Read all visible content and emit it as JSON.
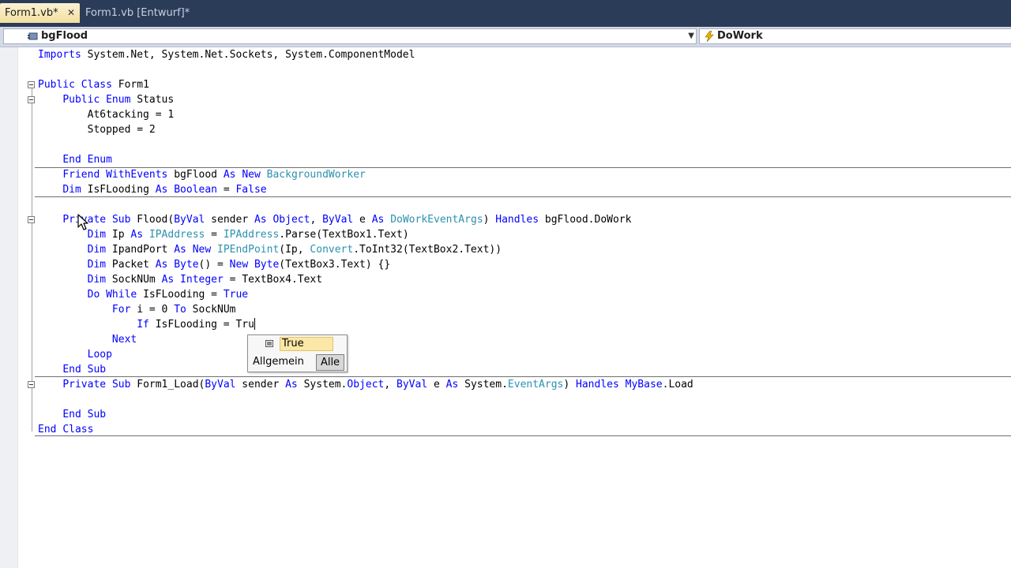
{
  "tabs": [
    {
      "label": "Form1.vb*",
      "active": true,
      "close_glyph": "✕"
    },
    {
      "label": "Form1.vb [Entwurf]*",
      "active": false
    }
  ],
  "navbar": {
    "class_combo": "bgFlood",
    "method_combo": "DoWork",
    "class_icon": "component-icon",
    "method_icon": "event-lightning-icon"
  },
  "code_lines": [
    [
      {
        "t": "Imports",
        "c": "kw"
      },
      {
        "t": " System.Net, System.Net.Sockets, System.ComponentModel"
      }
    ],
    [],
    [
      {
        "t": "Public",
        "c": "kw"
      },
      {
        "t": " "
      },
      {
        "t": "Class",
        "c": "kw"
      },
      {
        "t": " Form1"
      }
    ],
    [
      {
        "t": "    "
      },
      {
        "t": "Public",
        "c": "kw"
      },
      {
        "t": " "
      },
      {
        "t": "Enum",
        "c": "kw"
      },
      {
        "t": " Status"
      }
    ],
    [
      {
        "t": "        At6tacking = 1"
      }
    ],
    [
      {
        "t": "        Stopped = 2"
      }
    ],
    [],
    [
      {
        "t": "    "
      },
      {
        "t": "End",
        "c": "kw"
      },
      {
        "t": " "
      },
      {
        "t": "Enum",
        "c": "kw"
      }
    ],
    [
      {
        "t": "    "
      },
      {
        "t": "Friend",
        "c": "kw"
      },
      {
        "t": " "
      },
      {
        "t": "WithEvents",
        "c": "kw"
      },
      {
        "t": " bgFlood "
      },
      {
        "t": "As",
        "c": "kw"
      },
      {
        "t": " "
      },
      {
        "t": "New",
        "c": "kw"
      },
      {
        "t": " "
      },
      {
        "t": "BackgroundWorker",
        "c": "ty"
      }
    ],
    [
      {
        "t": "    "
      },
      {
        "t": "Dim",
        "c": "kw"
      },
      {
        "t": " IsFLooding "
      },
      {
        "t": "As",
        "c": "kw"
      },
      {
        "t": " "
      },
      {
        "t": "Boolean",
        "c": "kw"
      },
      {
        "t": " = "
      },
      {
        "t": "False",
        "c": "kw"
      }
    ],
    [],
    [
      {
        "t": "    "
      },
      {
        "t": "Private",
        "c": "kw"
      },
      {
        "t": " "
      },
      {
        "t": "Sub",
        "c": "kw"
      },
      {
        "t": " Flood("
      },
      {
        "t": "ByVal",
        "c": "kw"
      },
      {
        "t": " sender "
      },
      {
        "t": "As",
        "c": "kw"
      },
      {
        "t": " "
      },
      {
        "t": "Object",
        "c": "kw"
      },
      {
        "t": ", "
      },
      {
        "t": "ByVal",
        "c": "kw"
      },
      {
        "t": " e "
      },
      {
        "t": "As",
        "c": "kw"
      },
      {
        "t": " "
      },
      {
        "t": "DoWorkEventArgs",
        "c": "ty"
      },
      {
        "t": ") "
      },
      {
        "t": "Handles",
        "c": "kw"
      },
      {
        "t": " bgFlood.DoWork"
      }
    ],
    [
      {
        "t": "        "
      },
      {
        "t": "Dim",
        "c": "kw"
      },
      {
        "t": " Ip "
      },
      {
        "t": "As",
        "c": "kw"
      },
      {
        "t": " "
      },
      {
        "t": "IPAddress",
        "c": "ty"
      },
      {
        "t": " = "
      },
      {
        "t": "IPAddress",
        "c": "ty"
      },
      {
        "t": ".Parse(TextBox1.Text)"
      }
    ],
    [
      {
        "t": "        "
      },
      {
        "t": "Dim",
        "c": "kw"
      },
      {
        "t": " IpandPort "
      },
      {
        "t": "As",
        "c": "kw"
      },
      {
        "t": " "
      },
      {
        "t": "New",
        "c": "kw"
      },
      {
        "t": " "
      },
      {
        "t": "IPEndPoint",
        "c": "ty"
      },
      {
        "t": "(Ip, "
      },
      {
        "t": "Convert",
        "c": "ty"
      },
      {
        "t": ".ToInt32(TextBox2.Text))"
      }
    ],
    [
      {
        "t": "        "
      },
      {
        "t": "Dim",
        "c": "kw"
      },
      {
        "t": " Packet "
      },
      {
        "t": "As",
        "c": "kw"
      },
      {
        "t": " "
      },
      {
        "t": "Byte",
        "c": "kw"
      },
      {
        "t": "() = "
      },
      {
        "t": "New",
        "c": "kw"
      },
      {
        "t": " "
      },
      {
        "t": "Byte",
        "c": "kw"
      },
      {
        "t": "(TextBox3.Text) {}"
      }
    ],
    [
      {
        "t": "        "
      },
      {
        "t": "Dim",
        "c": "kw"
      },
      {
        "t": " SockNUm "
      },
      {
        "t": "As",
        "c": "kw"
      },
      {
        "t": " "
      },
      {
        "t": "Integer",
        "c": "kw"
      },
      {
        "t": " = TextBox4.Text"
      }
    ],
    [
      {
        "t": "        "
      },
      {
        "t": "Do",
        "c": "kw"
      },
      {
        "t": " "
      },
      {
        "t": "While",
        "c": "kw"
      },
      {
        "t": " IsFLooding = "
      },
      {
        "t": "True",
        "c": "kw"
      }
    ],
    [
      {
        "t": "            "
      },
      {
        "t": "For",
        "c": "kw"
      },
      {
        "t": " i = 0 "
      },
      {
        "t": "To",
        "c": "kw"
      },
      {
        "t": " SockNUm"
      }
    ],
    [
      {
        "t": "                "
      },
      {
        "t": "If",
        "c": "kw"
      },
      {
        "t": " IsFLooding = Tru"
      },
      {
        "t": "",
        "c": "caret"
      }
    ],
    [
      {
        "t": "            "
      },
      {
        "t": "Next",
        "c": "kw"
      }
    ],
    [
      {
        "t": "        "
      },
      {
        "t": "Loop",
        "c": "kw"
      }
    ],
    [
      {
        "t": "    "
      },
      {
        "t": "End",
        "c": "kw"
      },
      {
        "t": " "
      },
      {
        "t": "Sub",
        "c": "kw"
      }
    ],
    [
      {
        "t": "    "
      },
      {
        "t": "Private",
        "c": "kw"
      },
      {
        "t": " "
      },
      {
        "t": "Sub",
        "c": "kw"
      },
      {
        "t": " Form1_Load("
      },
      {
        "t": "ByVal",
        "c": "kw"
      },
      {
        "t": " sender "
      },
      {
        "t": "As",
        "c": "kw"
      },
      {
        "t": " System."
      },
      {
        "t": "Object",
        "c": "kw"
      },
      {
        "t": ", "
      },
      {
        "t": "ByVal",
        "c": "kw"
      },
      {
        "t": " e "
      },
      {
        "t": "As",
        "c": "kw"
      },
      {
        "t": " System."
      },
      {
        "t": "EventArgs",
        "c": "ty"
      },
      {
        "t": ") "
      },
      {
        "t": "Handles",
        "c": "kw"
      },
      {
        "t": " "
      },
      {
        "t": "MyBase",
        "c": "kw"
      },
      {
        "t": ".Load"
      }
    ],
    [],
    [
      {
        "t": "    "
      },
      {
        "t": "End",
        "c": "kw"
      },
      {
        "t": " "
      },
      {
        "t": "Sub",
        "c": "kw"
      }
    ],
    [
      {
        "t": "End",
        "c": "kw"
      },
      {
        "t": " "
      },
      {
        "t": "Class",
        "c": "kw"
      }
    ]
  ],
  "intellisense": {
    "selected_item": "True",
    "item_icon": "keyword-icon",
    "tab_common": "Allgemein",
    "tab_all": "Alle",
    "active_tab": "Alle"
  },
  "colors": {
    "keyword": "#0000ff",
    "type": "#2b91af",
    "text": "#000000",
    "tab_strip": "#2b3c59",
    "active_tab": "#f2dfa0",
    "completion_highlight": "#fbe7a6"
  }
}
